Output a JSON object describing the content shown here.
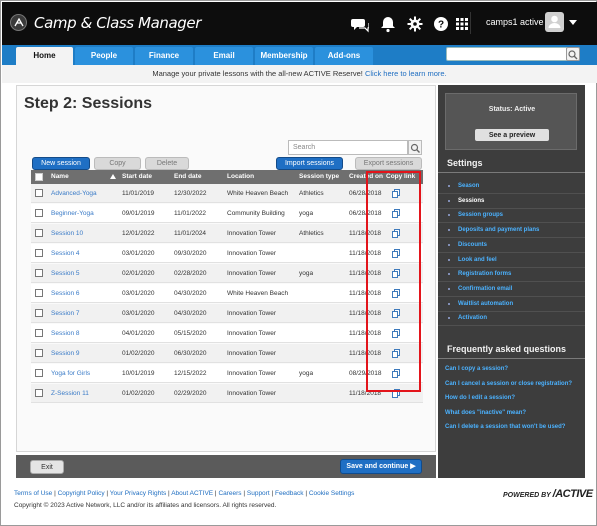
{
  "app": {
    "title": "Camp & Class Manager",
    "account": "camps1 active"
  },
  "tabs": [
    {
      "label": "Home"
    },
    {
      "label": "People"
    },
    {
      "label": "Finance"
    },
    {
      "label": "Email"
    },
    {
      "label": "Membership"
    },
    {
      "label": "Add-ons"
    }
  ],
  "promo": {
    "text": "Manage your private lessons with the all-new ACTIVE Reserve!",
    "link": "Click here to learn more."
  },
  "page": {
    "title": "Step 2: Sessions"
  },
  "toolbar": {
    "search_placeholder": "Search",
    "new_session": "New session",
    "copy": "Copy",
    "delete": "Delete",
    "import_sessions": "Import sessions",
    "export_sessions": "Export sessions"
  },
  "table": {
    "columns": [
      "Name",
      "Start date",
      "End date",
      "Location",
      "Session type",
      "Created on",
      "Copy link"
    ],
    "rows": [
      {
        "name": "Advanced-Yoga",
        "start": "11/01/2019",
        "end": "12/30/2022",
        "location": "White Heaven Beach",
        "type": "Athletics",
        "created": "06/28/2018"
      },
      {
        "name": "Beginner-Yoga",
        "start": "09/01/2019",
        "end": "11/01/2022",
        "location": "Community Building",
        "type": "yoga",
        "created": "06/28/2018"
      },
      {
        "name": "Session 10",
        "start": "12/01/2022",
        "end": "11/01/2024",
        "location": "Innovation Tower",
        "type": "Athletics",
        "created": "11/18/2018"
      },
      {
        "name": "Session 4",
        "start": "03/01/2020",
        "end": "09/30/2020",
        "location": "Innovation Tower",
        "type": "",
        "created": "11/18/2018"
      },
      {
        "name": "Session 5",
        "start": "02/01/2020",
        "end": "02/28/2020",
        "location": "Innovation Tower",
        "type": "yoga",
        "created": "11/18/2018"
      },
      {
        "name": "Session 6",
        "start": "03/01/2020",
        "end": "04/30/2020",
        "location": "White Heaven Beach",
        "type": "",
        "created": "11/18/2018"
      },
      {
        "name": "Session 7",
        "start": "03/01/2020",
        "end": "04/30/2020",
        "location": "Innovation Tower",
        "type": "",
        "created": "11/18/2018"
      },
      {
        "name": "Session 8",
        "start": "04/01/2020",
        "end": "05/15/2020",
        "location": "Innovation Tower",
        "type": "",
        "created": "11/18/2018"
      },
      {
        "name": "Session 9",
        "start": "01/02/2020",
        "end": "06/30/2020",
        "location": "Innovation Tower",
        "type": "",
        "created": "11/18/2018"
      },
      {
        "name": "Yoga for Girls",
        "start": "10/01/2019",
        "end": "12/15/2022",
        "location": "Innovation Tower",
        "type": "yoga",
        "created": "08/29/2018"
      },
      {
        "name": "Z-Session 11",
        "start": "01/02/2020",
        "end": "02/29/2020",
        "location": "Innovation Tower",
        "type": "",
        "created": "11/18/2018"
      }
    ]
  },
  "bottom": {
    "exit": "Exit",
    "save": "Save and continue ▶"
  },
  "sidebar": {
    "status": "Status: Active",
    "preview": "See a preview",
    "settings_head": "Settings",
    "settings": [
      "Season",
      "Sessions",
      "Session groups",
      "Deposits and payment plans",
      "Discounts",
      "Look and feel",
      "Registration forms",
      "Confirmation email",
      "Waitlist automation",
      "Activation"
    ],
    "faq_head": "Frequently asked questions",
    "faqs": [
      "Can I copy a session?",
      "Can I cancel a session or close registration?",
      "How do I edit a session?",
      "What does \"inactive\" mean?",
      "Can I delete a session that won't be used?"
    ]
  },
  "footer": {
    "links": [
      "Terms of Use",
      "Copyright Policy",
      "Your Privacy Rights",
      "About ACTIVE",
      "Careers",
      "Support",
      "Feedback",
      "Cookie Settings"
    ],
    "copyright": "Copyright © 2023 Active Network, LLC and/or its affiliates and licensors. All rights reserved.",
    "powered": "POWERED BY ACTIVE"
  }
}
